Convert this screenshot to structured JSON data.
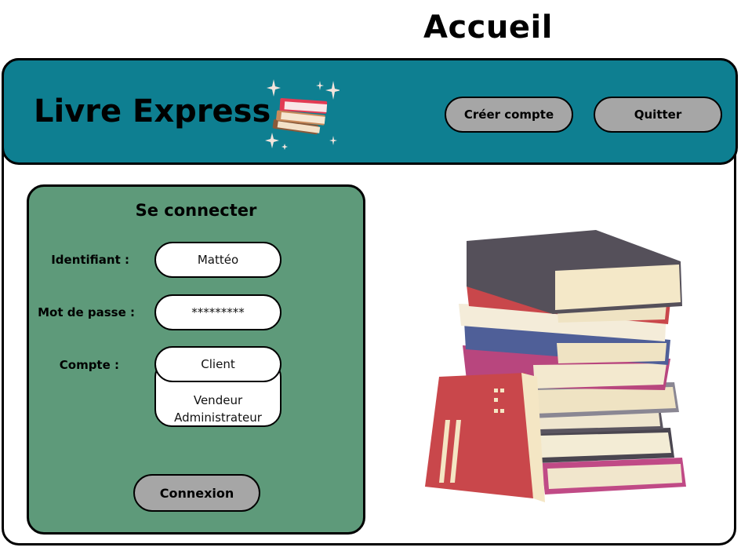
{
  "page": {
    "title": "Accueil"
  },
  "header": {
    "brand": "Livre Express",
    "buttons": {
      "create_account": "Créer compte",
      "quit": "Quitter"
    }
  },
  "login": {
    "title": "Se connecter",
    "fields": {
      "username": {
        "label": "Identifiant :",
        "value": "Mattéo"
      },
      "password": {
        "label": "Mot de passe :",
        "value": "*********"
      },
      "account": {
        "label": "Compte :",
        "selected": "Client",
        "options": [
          "Vendeur",
          "Administrateur"
        ]
      }
    },
    "submit": "Connexion"
  },
  "colors": {
    "header_bg": "#0e7f91",
    "panel_bg": "#5e9a7a",
    "button_bg": "#a6a6a6"
  },
  "icons": {
    "logo": "books-sparkles-icon",
    "illustration": "book-stack-icon"
  }
}
